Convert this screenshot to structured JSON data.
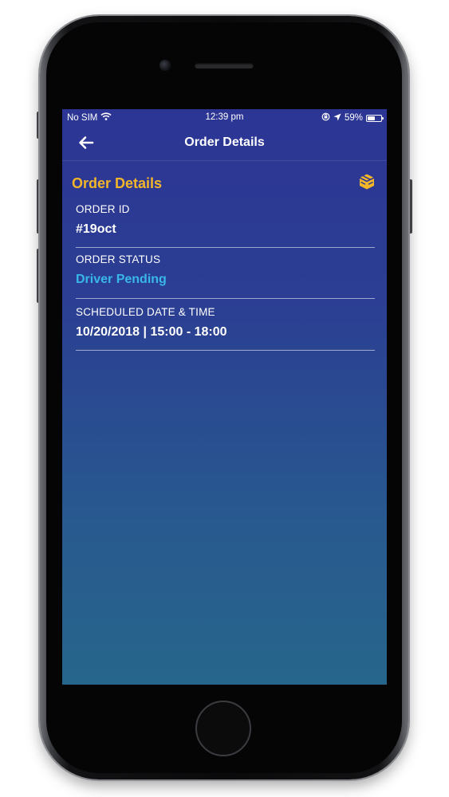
{
  "status_bar": {
    "carrier": "No SIM",
    "time": "12:39 pm",
    "battery_percent": "59%",
    "battery_level": 0.59,
    "icons": [
      "wifi-icon",
      "orientation-lock-icon",
      "location-arrow-icon",
      "battery-icon"
    ]
  },
  "nav": {
    "title": "Order Details",
    "back_icon": "arrow-left-icon"
  },
  "section": {
    "title": "Order Details",
    "action_icon": "box-icon"
  },
  "fields": [
    {
      "label": "ORDER ID",
      "value": "#19oct"
    },
    {
      "label": "ORDER STATUS",
      "value": "Driver Pending"
    },
    {
      "label": "SCHEDULED DATE & TIME",
      "value": "10/20/2018 | 15:00 - 18:00"
    }
  ],
  "colors": {
    "accent": "#f4b629",
    "status": "#39b7e9",
    "screen_top": "#2c3594",
    "screen_bottom": "#27668c"
  }
}
